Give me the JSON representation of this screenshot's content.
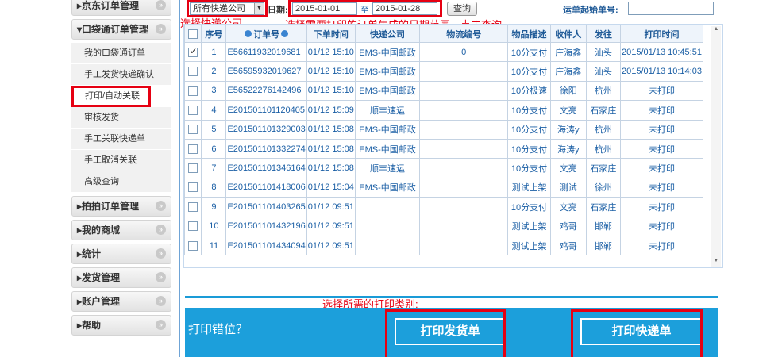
{
  "sidebar": {
    "groups_top": [
      {
        "label": "京东订单管理"
      }
    ],
    "active_group": {
      "label": "口袋通订单管理"
    },
    "sub_items": [
      {
        "label": "我的口袋通订单"
      },
      {
        "label": "手工发货快递确认"
      },
      {
        "label": "打印/自动关联"
      },
      {
        "label": "审核发货"
      },
      {
        "label": "手工关联快递单"
      },
      {
        "label": "手工取消关联"
      },
      {
        "label": "高级查询"
      }
    ],
    "groups_bottom": [
      {
        "label": "拍拍订单管理"
      },
      {
        "label": "我的商城"
      },
      {
        "label": "统计"
      },
      {
        "label": "发货管理"
      },
      {
        "label": "账户管理"
      },
      {
        "label": "帮助"
      }
    ]
  },
  "toolbar": {
    "carrier_select": "所有快递公司",
    "date_label": "日期:",
    "date_from": "2015-01-01",
    "date_to_label": "至",
    "date_to": "2015-01-28",
    "query_button": "查询",
    "waybill_label": "运单起始单号:",
    "waybill_value": ""
  },
  "hints": {
    "carrier": "选择快递公司",
    "date": "选择需要打印的订单生成的日期范围，点击查询",
    "print_type": "选择所需的打印类别:"
  },
  "table": {
    "headers": [
      "序号",
      "订单号",
      "下单时间",
      "快递公司",
      "物流编号",
      "物品描述",
      "收件人",
      "发往",
      "打印时间"
    ],
    "rows": [
      {
        "checked": true,
        "no": "1",
        "order": "E56611932019681",
        "time": "01/12 15:10",
        "carrier": "EMS-中国邮政",
        "tracking": "0",
        "desc": "10分支付",
        "recipient": "庄海鑫",
        "dest": "汕头",
        "print_time": "2015/01/13 10:45:51"
      },
      {
        "checked": false,
        "no": "2",
        "order": "E56595932019627",
        "time": "01/12 15:10",
        "carrier": "EMS-中国邮政",
        "tracking": "",
        "desc": "10分支付",
        "recipient": "庄海鑫",
        "dest": "汕头",
        "print_time": "2015/01/13 10:14:03"
      },
      {
        "checked": false,
        "no": "3",
        "order": "E56522276142496",
        "time": "01/12 15:10",
        "carrier": "EMS-中国邮政",
        "tracking": "",
        "desc": "10分极速",
        "recipient": "徐阳",
        "dest": "杭州",
        "print_time": "未打印"
      },
      {
        "checked": false,
        "no": "4",
        "order": "E201501101120405",
        "time": "01/12 15:09",
        "carrier": "顺丰速运",
        "tracking": "",
        "desc": "10分支付",
        "recipient": "文亮",
        "dest": "石家庄",
        "print_time": "未打印"
      },
      {
        "checked": false,
        "no": "5",
        "order": "E201501101329003",
        "time": "01/12 15:08",
        "carrier": "EMS-中国邮政",
        "tracking": "",
        "desc": "10分支付",
        "recipient": "海涛y",
        "dest": "杭州",
        "print_time": "未打印"
      },
      {
        "checked": false,
        "no": "6",
        "order": "E201501101332274",
        "time": "01/12 15:08",
        "carrier": "EMS-中国邮政",
        "tracking": "",
        "desc": "10分支付",
        "recipient": "海涛y",
        "dest": "杭州",
        "print_time": "未打印"
      },
      {
        "checked": false,
        "no": "7",
        "order": "E201501101346164",
        "time": "01/12 15:08",
        "carrier": "顺丰速运",
        "tracking": "",
        "desc": "10分支付",
        "recipient": "文亮",
        "dest": "石家庄",
        "print_time": "未打印"
      },
      {
        "checked": false,
        "no": "8",
        "order": "E201501101418006",
        "time": "01/12 15:04",
        "carrier": "EMS-中国邮政",
        "tracking": "",
        "desc": "测试上架",
        "recipient": "测试",
        "dest": "徐州",
        "print_time": "未打印"
      },
      {
        "checked": false,
        "no": "9",
        "order": "E201501101403265",
        "time": "01/12 09:51",
        "carrier": "",
        "tracking": "",
        "desc": "10分支付",
        "recipient": "文亮",
        "dest": "石家庄",
        "print_time": "未打印"
      },
      {
        "checked": false,
        "no": "10",
        "order": "E201501101432196",
        "time": "01/12 09:51",
        "carrier": "",
        "tracking": "",
        "desc": "测试上架",
        "recipient": "鸡哥",
        "dest": "邯郸",
        "print_time": "未打印"
      },
      {
        "checked": false,
        "no": "11",
        "order": "E201501101434094",
        "time": "01/12 09:51",
        "carrier": "",
        "tracking": "",
        "desc": "测试上架",
        "recipient": "鸡哥",
        "dest": "邯郸",
        "print_time": "未打印"
      }
    ]
  },
  "print_bar": {
    "error_link": "打印错位？",
    "ship_button": "打印发货单",
    "express_button": "打印快递单"
  }
}
